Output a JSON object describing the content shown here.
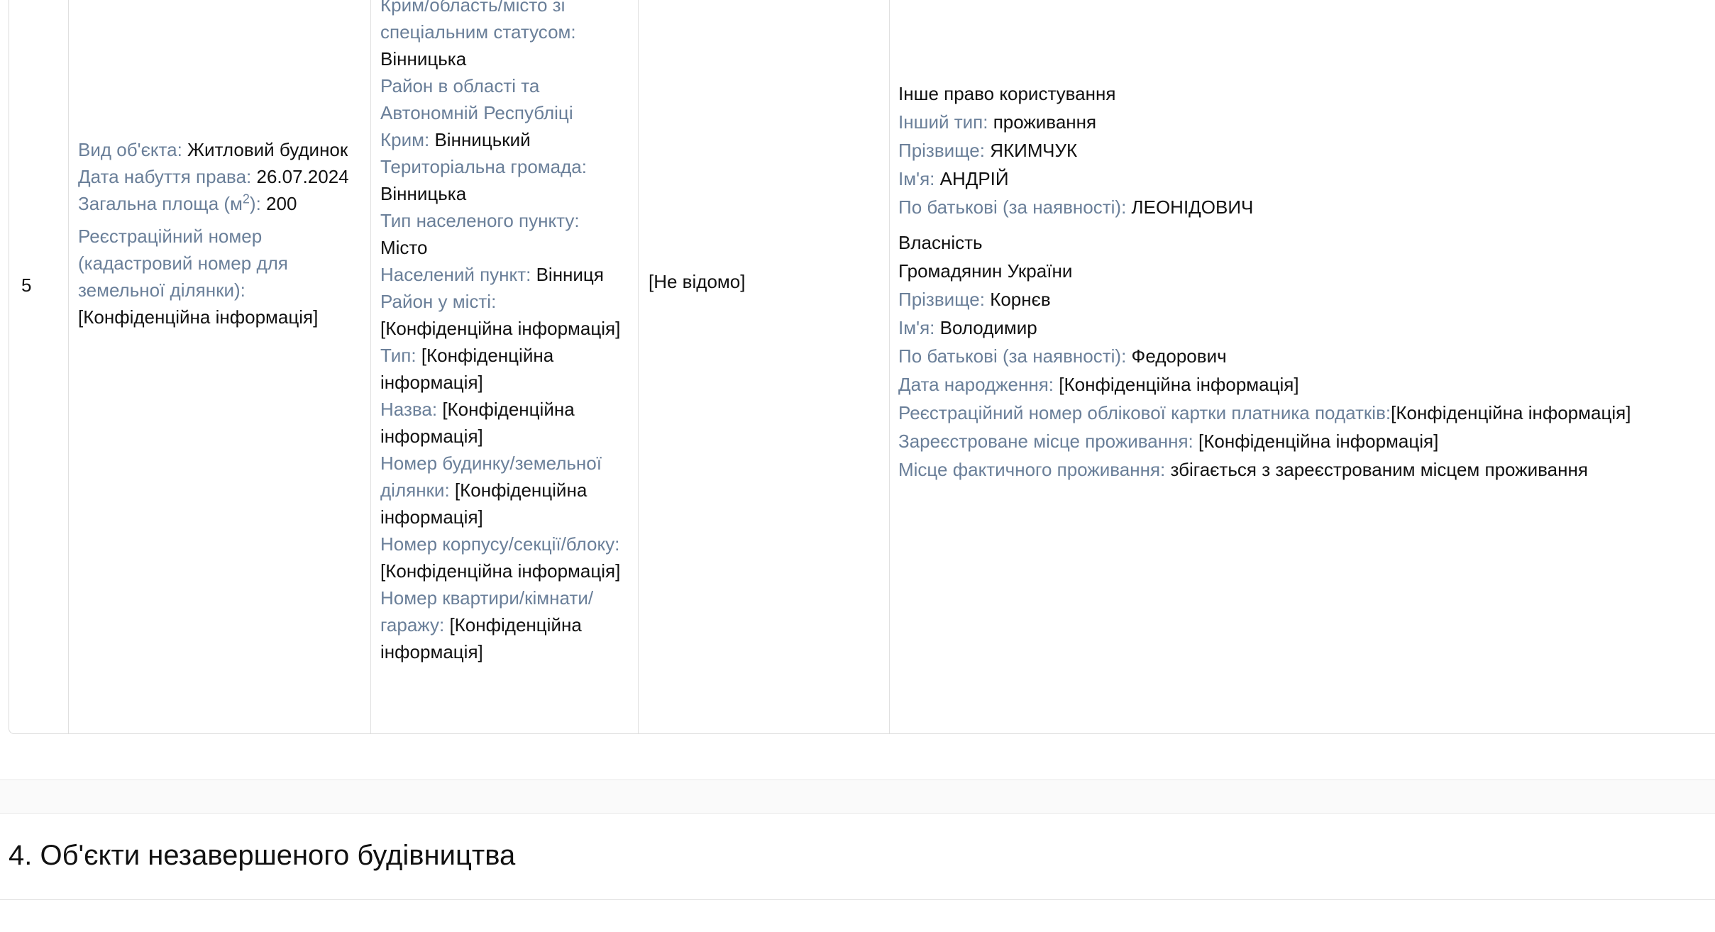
{
  "row": {
    "number": "5",
    "object": {
      "type_label": "Вид об'єкта:",
      "type_value": "Житловий будинок",
      "date_label": "Дата набуття права:",
      "date_value": "26.07.2024",
      "area_label_pre": "Загальна площа (м",
      "area_label_sup": "2",
      "area_label_post": "):",
      "area_value": "200",
      "regnum_label": "Реєстраційний номер (кадастровий номер для земельної ділянки):",
      "regnum_value": "[Конфіденційна інформація]"
    },
    "address": {
      "crimea_label": "Крим/область/місто зі спеціальним статусом:",
      "crimea_value": "Вінницька",
      "district_label": "Район в області та Автономній Республіці Крим:",
      "district_value": "Вінницький",
      "community_label": "Територіальна громада:",
      "community_value": "Вінницька",
      "settlement_type_label": "Тип населеного пункту:",
      "settlement_type_value": "Місто",
      "settlement_label": "Населений пункт:",
      "settlement_value": "Вінниця",
      "city_district_label": "Район у місті:",
      "city_district_value": "[Конфіденційна інформація]",
      "type_label": "Тип:",
      "type_value": "[Конфіденційна інформація]",
      "name_label": "Назва:",
      "name_value": "[Конфіденційна інформація]",
      "house_label": "Номер будинку/земельної ділянки:",
      "house_value": "[Конфіденційна інформація]",
      "building_label": "Номер корпусу/секції/блоку:",
      "building_value": "[Конфіденційна інформація]",
      "apartment_label": "Номер квартири/кімнати/гаражу:",
      "apartment_value": "[Конфіденційна інформація]"
    },
    "value": "[Не відомо]",
    "rights": {
      "group1": {
        "title": "Інше право користування",
        "other_type_label": "Інший тип:",
        "other_type_value": "проживання",
        "surname_label": "Прізвище:",
        "surname_value": "ЯКИМЧУК",
        "name_label": "Ім'я:",
        "name_value": "АНДРІЙ",
        "patronymic_label": "По батькові (за наявності):",
        "patronymic_value": "ЛЕОНІДОВИЧ"
      },
      "group2": {
        "title": "Власність",
        "citizenship": "Громадянин України",
        "surname_label": "Прізвище:",
        "surname_value": "Корнєв",
        "name_label": "Ім'я:",
        "name_value": "Володимир",
        "patronymic_label": "По батькові (за наявності):",
        "patronymic_value": "Федорович",
        "birth_label": "Дата народження:",
        "birth_value": "[Конфіденційна інформація]",
        "tax_label": "Реєстраційний номер облікової картки платника податків:",
        "tax_value": "[Конфіденційна інформація]",
        "registered_label": "Зареєстроване місце проживання:",
        "registered_value": "[Конфіденційна інформація]",
        "actual_label": "Місце фактичного проживання:",
        "actual_value": "збігається з зареєстрованим місцем проживання"
      }
    }
  },
  "section": {
    "title": "4. Об'єкти незавершеного будівництва"
  }
}
